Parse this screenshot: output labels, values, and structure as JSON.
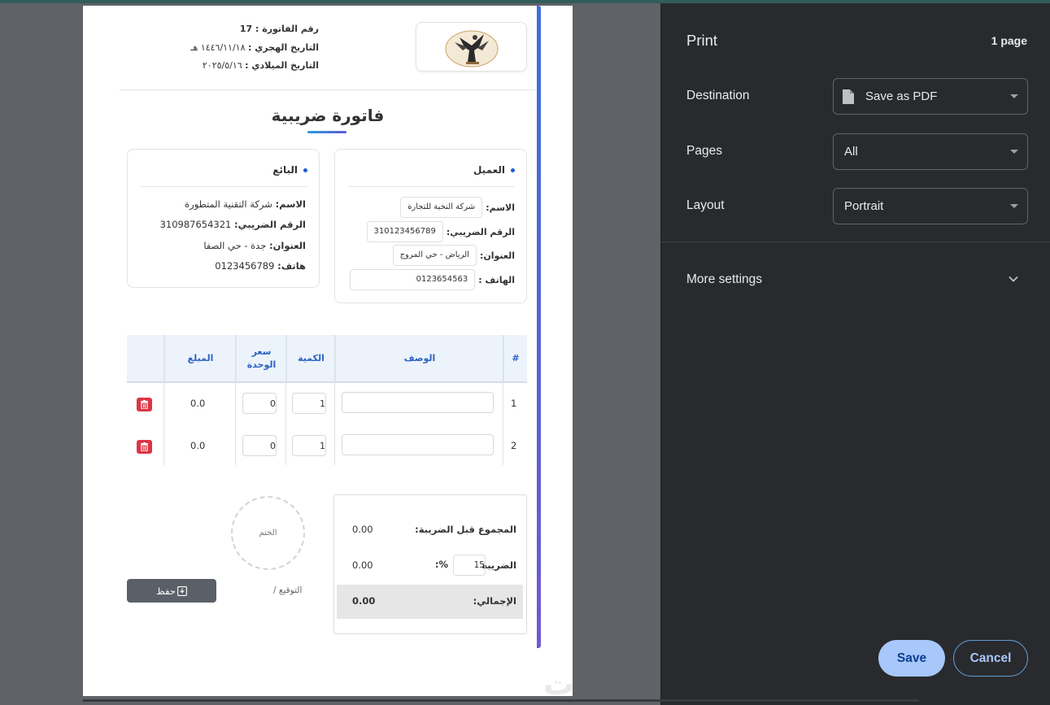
{
  "invoice": {
    "number_line": "رقم الفاتورة : 17",
    "hijri_label": "التاريخ الهجري :",
    "hijri_value": "١٤٤٦/١١/١٨ هـ",
    "greg_label": "التاريخ الميلادي :",
    "greg_value": "٢٠٢٥/٥/١٦",
    "title": "فاتورة ضريبية",
    "customer": {
      "heading": "العميل",
      "name_label": "الاسم:",
      "name_value": "شركة النخبة للتجارة",
      "tax_label": "الرقم الضريبي:",
      "tax_value": "310123456789",
      "address_label": "العنوان:",
      "address_value": "الرياض - حي المروج",
      "phone_label": "الهاتف :",
      "phone_value": "0123654563"
    },
    "seller": {
      "heading": "البائع",
      "name_label": "الاسم:",
      "name_value": "شركة التقنية المتطورة",
      "tax_label": "الرقم الضريبي:",
      "tax_value": "310987654321",
      "address_label": "العنوان:",
      "address_value": "جدة - حي الصفا",
      "phone_label": "هاتف:",
      "phone_value": "0123456789"
    },
    "table": {
      "headers": [
        "#",
        "الوصف",
        "الكمية",
        "سعر الوحدة",
        "المبلغ"
      ],
      "rows": [
        {
          "index": "1",
          "description": "",
          "qty": "1",
          "price": "0",
          "amount": "0.0"
        },
        {
          "index": "2",
          "description": "",
          "qty": "1",
          "price": "0",
          "amount": "0.0"
        }
      ]
    },
    "totals": {
      "subtotal_label": "المجموع قبل الضريبة:",
      "subtotal_value": "0.00",
      "tax_label": "الضريبة",
      "tax_percent_sign": "%:",
      "tax_rate": "15",
      "tax_value": "0.00",
      "grand_label": "الإجمالي:",
      "grand_value": "0.00"
    },
    "stamp_label": "الختم",
    "signature_label": "التوقيع /",
    "save_button": "حفظ"
  },
  "watermark": "خمسات",
  "print_dialog": {
    "title": "Print",
    "page_count": "1 page",
    "destination_label": "Destination",
    "destination_value": "Save as PDF",
    "pages_label": "Pages",
    "pages_value": "All",
    "layout_label": "Layout",
    "layout_value": "Portrait",
    "more_settings": "More settings",
    "save": "Save",
    "cancel": "Cancel"
  },
  "colors": {
    "accent_blue": "#2c63c2",
    "delete_red": "#dc3545",
    "dialog_bg": "#292a2d",
    "save_button_bg": "#a8c7fa"
  }
}
